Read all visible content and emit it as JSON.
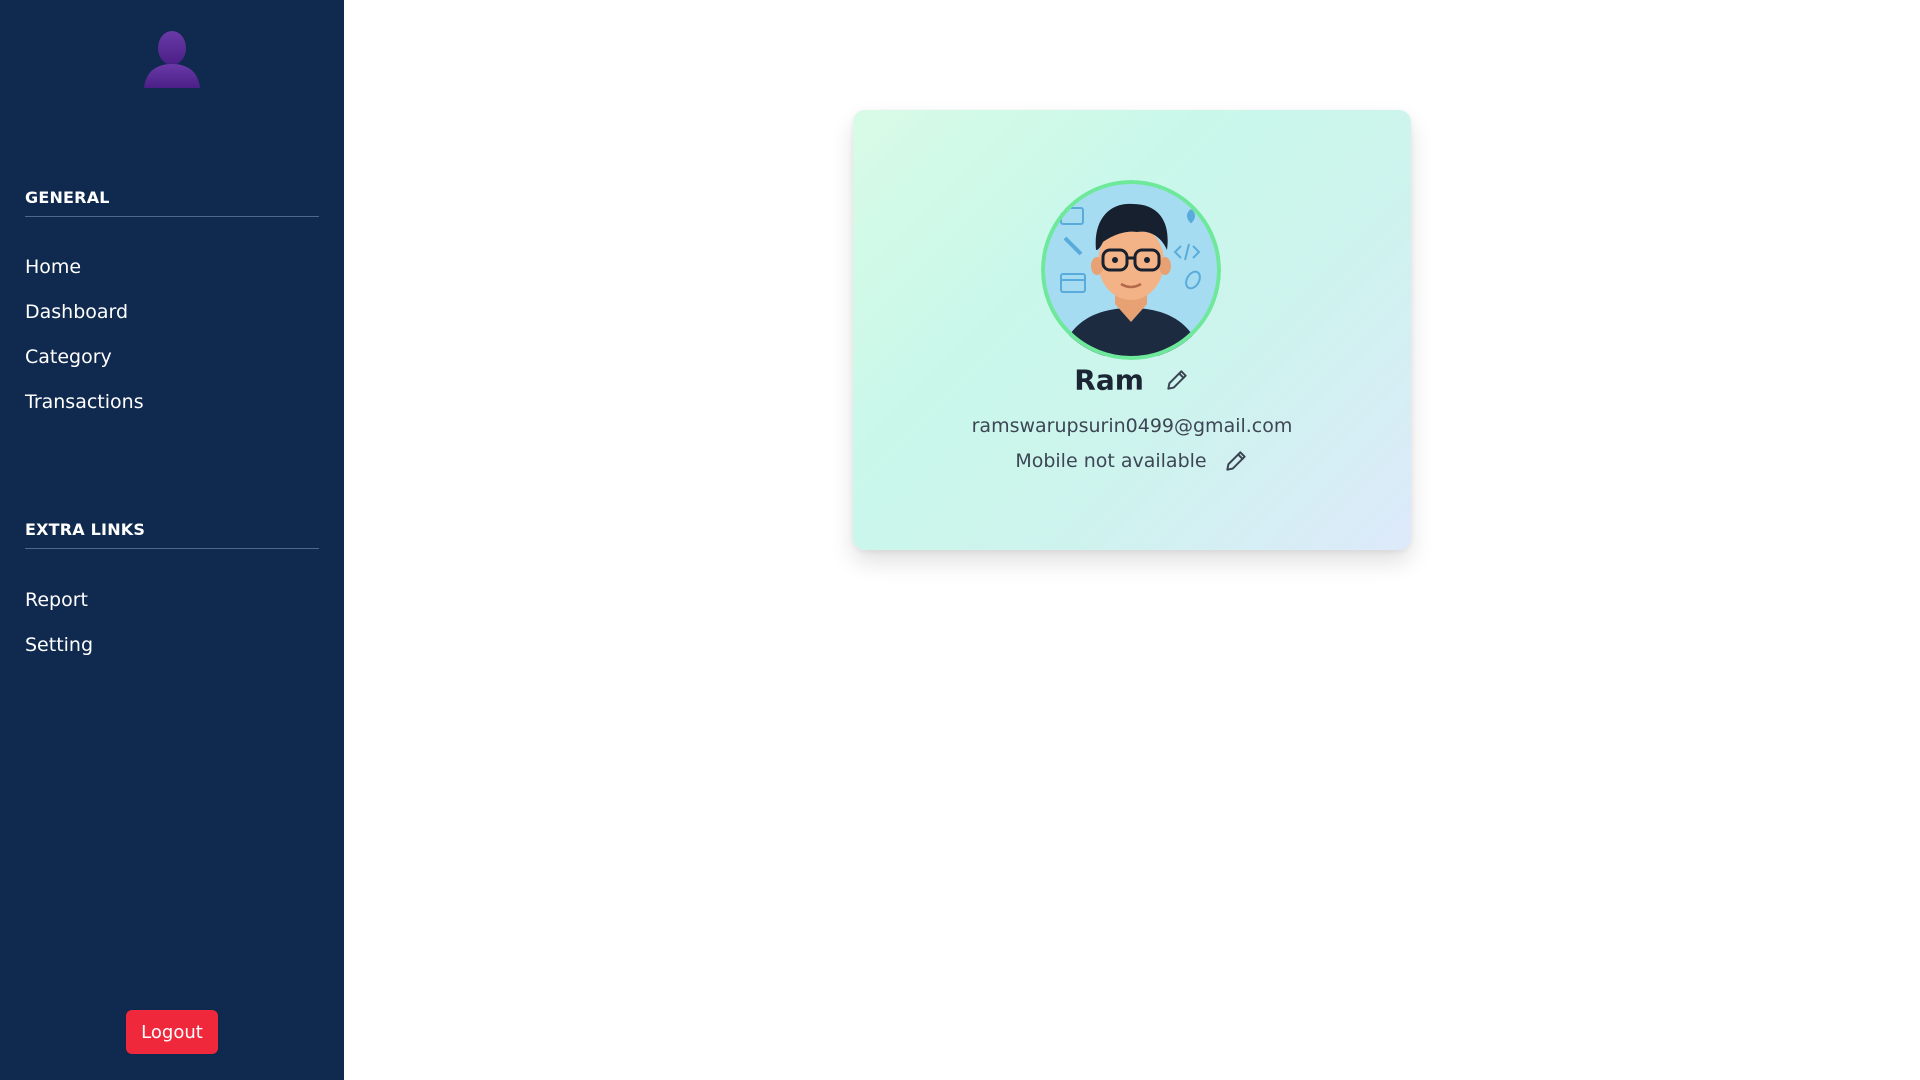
{
  "sidebar": {
    "avatar_icon": "user-silhouette-icon",
    "sections": [
      {
        "heading": "GENERAL",
        "items": [
          "Home",
          "Dashboard",
          "Category",
          "Transactions"
        ]
      },
      {
        "heading": "EXTRA LINKS",
        "items": [
          "Report",
          "Setting"
        ]
      }
    ],
    "logout_label": "Logout"
  },
  "profile": {
    "avatar_icon": "developer-avatar-icon",
    "name": "Ram",
    "email": "ramswarupsurin0499@gmail.com",
    "mobile": "Mobile not available",
    "edit_icon": "pencil-icon"
  },
  "colors": {
    "sidebar_bg": "#0f2a4e",
    "logout_bg": "#f0283c",
    "avatar_ring": "#6ee89a",
    "avatar_bg": "#a6dcf2"
  }
}
